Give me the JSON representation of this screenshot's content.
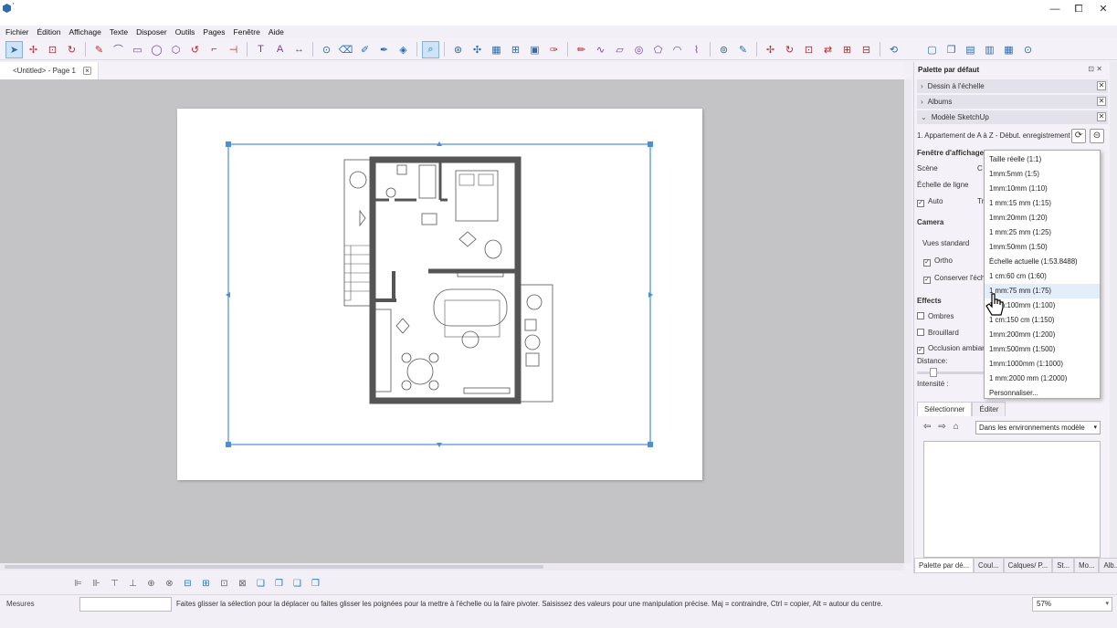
{
  "window": {
    "title": "'",
    "min_label": "—",
    "max_label": "⧠",
    "close_label": "✕"
  },
  "menu": [
    "Fichier",
    "Édition",
    "Affichage",
    "Texte",
    "Disposer",
    "Outils",
    "Pages",
    "Fenêtre",
    "Aide"
  ],
  "doc_tab": {
    "label": "<Untitled> - Page 1",
    "close": "×"
  },
  "panel": {
    "title": "Palette par défaut",
    "title_ctrls": "⊡ ✕",
    "trays": [
      {
        "label": "Dessin à l'échelle",
        "chev": "›",
        "close": "✕"
      },
      {
        "label": "Albums",
        "chev": "›",
        "close": "✕"
      },
      {
        "label": "Modèle SketchUp",
        "chev": "⌄",
        "close": "✕"
      }
    ],
    "model_name": "1. Appartement de A à Z - Début. enregistrement",
    "viewport_heading": "Fenêtre d'affichage",
    "scene_label": "Scène",
    "scene_value": "C",
    "line_scale_label": "Échelle de ligne",
    "auto_label": "Auto",
    "auto_value": "Tr",
    "camera_heading": "Camera",
    "standard_views": "Vues standard",
    "ortho_label": "Ortho",
    "preserve_label": "Conserver l'éch",
    "effects_heading": "Effects",
    "shadows_label": "Ombres",
    "fog_label": "Brouillard",
    "ao_label": "Occlusion ambian",
    "distance_label": "Distance:",
    "intensity_label": "Intensité :",
    "tab_select": "Sélectionner",
    "tab_edit": "Éditer",
    "env_select": "Dans les environnements modèle",
    "bottom_tabs": [
      "Palette par dé...",
      "Coul...",
      "Calques/ P...",
      "St...",
      "Mo...",
      "Alb..."
    ]
  },
  "scale_dropdown": {
    "items": [
      "Taille réelle (1:1)",
      "1mm:5mm (1:5)",
      "1mm:10mm (1:10)",
      "1 mm:15 mm (1:15)",
      "1mm:20mm (1:20)",
      "1 mm:25 mm (1:25)",
      "1mm:50mm (1:50)",
      "Échelle actuelle (1:53.8488)",
      "1 cm:60 cm (1:60)",
      "1 mm:75 mm (1:75)",
      "1mm:100mm (1:100)",
      "1 cm:150 cm (1:150)",
      "1mm:200mm (1:200)",
      "1mm:500mm (1:500)",
      "1mm:1000mm (1:1000)",
      "1 mm:2000 mm (1:2000)",
      "Personnaliser..."
    ],
    "hovered_index": 9
  },
  "status": {
    "measure_label": "Mesures",
    "hint": "Faites glisser la sélection pour la déplacer ou faites glisser les poignées pour la mettre à l'échelle ou la faire pivoter. Saisissez des valeurs pour une manipulation précise. Maj = contraindre, Ctrl = copier, Alt = autour du centre.",
    "zoom": "57%"
  },
  "colors": {
    "accent_blue": "#4a90d9",
    "wall": "#555555",
    "canvas": "#c4c3c6"
  }
}
